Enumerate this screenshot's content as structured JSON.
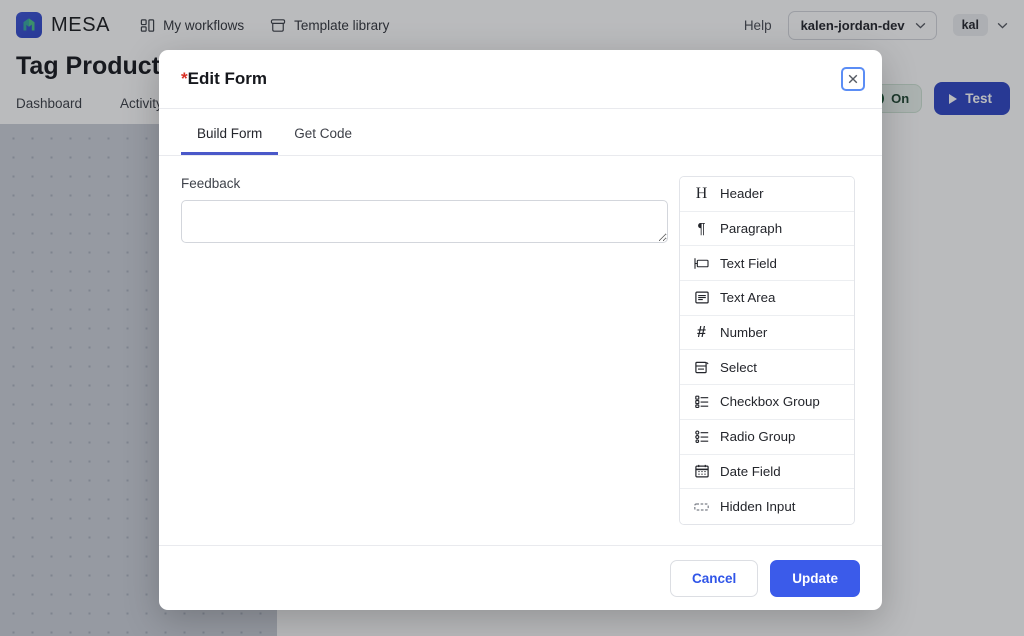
{
  "topbar": {
    "brand_name": "MESA",
    "logo_icon": "mesa-logo-icon",
    "nav": [
      {
        "label": "My workflows",
        "icon": "grid-layout-icon"
      },
      {
        "label": "Template library",
        "icon": "archive-box-icon"
      }
    ],
    "help_label": "Help",
    "store_select": {
      "value": "kalen-jordan-dev",
      "icon": "chevron-down-icon"
    },
    "account": {
      "name": "kal",
      "icon": "chevron-down-icon"
    }
  },
  "workflow": {
    "title": "Tag Product Wh",
    "subtabs": [
      {
        "label": "Dashboard"
      },
      {
        "label": "Activity"
      }
    ],
    "toggle": {
      "label": "On",
      "state": "on",
      "color": "#15502f"
    },
    "test_button": {
      "label": "Test",
      "icon": "play-icon",
      "color": "#2f45c5"
    }
  },
  "modal": {
    "title": "Edit Form",
    "required_marker": "*",
    "close_icon": "close-icon",
    "tabs": [
      {
        "label": "Build Form",
        "active": true
      },
      {
        "label": "Get Code",
        "active": false
      }
    ],
    "accent_color": "#4a58c9",
    "form_preview": {
      "fields": [
        {
          "label": "Feedback",
          "type": "textarea",
          "value": "",
          "placeholder": ""
        }
      ]
    },
    "palette": {
      "items": [
        {
          "label": "Header",
          "icon": "heading-icon"
        },
        {
          "label": "Paragraph",
          "icon": "paragraph-icon"
        },
        {
          "label": "Text Field",
          "icon": "text-field-icon"
        },
        {
          "label": "Text Area",
          "icon": "text-area-icon"
        },
        {
          "label": "Number",
          "icon": "number-hash-icon"
        },
        {
          "label": "Select",
          "icon": "select-dropdown-icon"
        },
        {
          "label": "Checkbox Group",
          "icon": "checkbox-list-icon"
        },
        {
          "label": "Radio Group",
          "icon": "radio-list-icon"
        },
        {
          "label": "Date Field",
          "icon": "calendar-icon"
        },
        {
          "label": "Hidden Input",
          "icon": "hidden-input-icon"
        }
      ]
    },
    "footer": {
      "cancel_label": "Cancel",
      "update_label": "Update",
      "update_color": "#3b5bea",
      "cancel_text_color": "#3055e8"
    }
  }
}
